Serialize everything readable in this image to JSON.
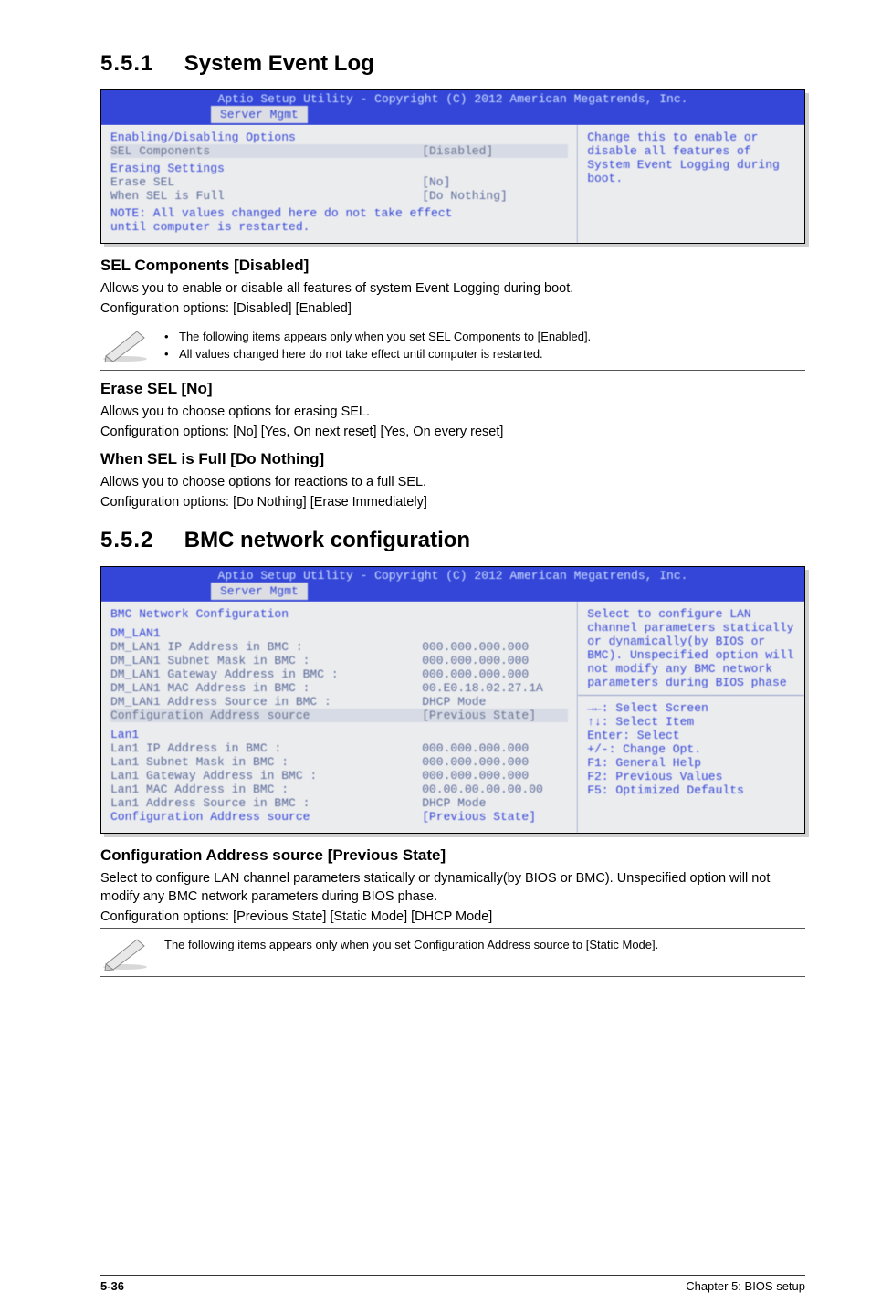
{
  "section1": {
    "number": "5.5.1",
    "title": "System Event Log"
  },
  "bios1": {
    "header_title": "Aptio Setup Utility - Copyright (C) 2012 American Megatrends, Inc.",
    "tab": "Server Mgmt",
    "left": {
      "l1": "Enabling/Disabling Options",
      "l1_sel": "SEL Components",
      "l1_val": "[Disabled]",
      "grp_title": "Erasing Settings",
      "r2_lab": "Erase SEL",
      "r2_val": "[No]",
      "r3_lab": "When SEL is Full",
      "r3_val": "[Do Nothing]",
      "note1": "NOTE: All values changed here do not take effect",
      "note2": "      until computer is restarted."
    },
    "right": "Change this to enable or disable all features of System Event Logging during boot."
  },
  "sel_components": {
    "title": "SEL Components [Disabled]",
    "p1": "Allows you to enable or disable all features of system Event Logging during boot.",
    "p2": "Configuration options: [Disabled] [Enabled]"
  },
  "notes1": {
    "a": "The following items appears only when you set SEL Components to [Enabled].",
    "b": "All values changed here do not take effect until computer is restarted."
  },
  "erase_sel": {
    "title": "Erase SEL [No]",
    "p1": "Allows you to choose options for erasing SEL.",
    "p2": "Configuration options: [No] [Yes, On next reset] [Yes, On every reset]"
  },
  "when_full": {
    "title": "When SEL is Full [Do Nothing]",
    "p1": "Allows you to choose options for reactions to a full SEL.",
    "p2": "Configuration options: [Do Nothing] [Erase Immediately]"
  },
  "section2": {
    "number": "5.5.2",
    "title": "BMC network configuration"
  },
  "bios2": {
    "header_title": "Aptio Setup Utility - Copyright (C) 2012 American Megatrends, Inc.",
    "tab": "Server Mgmt",
    "left": {
      "title": "BMC Network Configuration",
      "dm": "DM_LAN1",
      "a1": "DM_LAN1 IP Address in BMC :",
      "a1v": "000.000.000.000",
      "a2": "DM_LAN1 Subnet Mask in BMC :",
      "a2v": "000.000.000.000",
      "a3": "DM_LAN1 Gateway Address in BMC :",
      "a3v": "000.000.000.000",
      "a4": "DM_LAN1 MAC Address in BMC :",
      "a4v": "00.E0.18.02.27.1A",
      "a5": "DM_LAN1 Address Source in BMC :",
      "a5v": "DHCP Mode",
      "a6": "Configuration Address source",
      "a6v": "[Previous State]",
      "lan1": "Lan1",
      "b1": "Lan1 IP Address in BMC :",
      "b1v": "000.000.000.000",
      "b2": "Lan1 Subnet Mask in BMC :",
      "b2v": "000.000.000.000",
      "b3": "Lan1 Gateway Address in BMC :",
      "b3v": "000.000.000.000",
      "b4": "Lan1 MAC Address in BMC :",
      "b4v": "00.00.00.00.00.00",
      "b5": "Lan1 Address Source in BMC :",
      "b5v": "DHCP Mode",
      "b6": "Configuration Address source",
      "b6v": "[Previous State]"
    },
    "right": {
      "help": "Select to configure LAN channel parameters statically or dynamically(by BIOS or BMC). Unspecified option will not modify any BMC network parameters during BIOS phase",
      "n1": "→←: Select Screen",
      "n2": "↑↓: Select Item",
      "n3": "Enter: Select",
      "n4": "+/-: Change Opt.",
      "n5": "F1: General Help",
      "n6": "F2: Previous Values",
      "n7": "F5: Optimized Defaults"
    }
  },
  "config_addr": {
    "title": "Configuration Address source [Previous State]",
    "p1": "Select to configure LAN channel parameters statically or dynamically(by BIOS or BMC). Unspecified option will not modify any BMC network parameters during BIOS phase.",
    "p2": "Configuration options: [Previous State] [Static Mode] [DHCP Mode]"
  },
  "notes2": {
    "a": "The following items appears only when you set Configuration Address source to [Static Mode]."
  },
  "footer": {
    "page": "5-36",
    "chapter": "Chapter 5: BIOS setup"
  }
}
